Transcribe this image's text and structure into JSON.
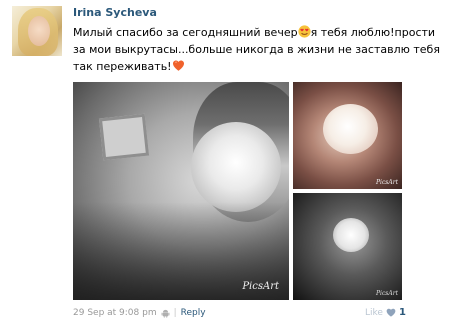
{
  "post": {
    "author": "Irina Sycheva",
    "text_line1_a": "Милый спасибо за сегодняшний вечер",
    "text_line1_b": "я тебя люблю!прости",
    "text_line2": "за мои выкрутасы...больше никогда в жизни не заставлю тебя",
    "text_line3": "так переживать!",
    "emoji_1": "smiling-face-with-heart-eyes",
    "emoji_2": "orange-heart",
    "photos": [
      {
        "watermark": "PicsArt"
      },
      {
        "watermark": "PicsArt"
      },
      {
        "watermark": "PicsArt"
      }
    ],
    "footer": {
      "date": "29 Sep at 9:08 pm",
      "separator": "|",
      "reply": "Reply"
    },
    "like": {
      "label": "Like",
      "count": "1"
    }
  },
  "colors": {
    "link": "#2b587a",
    "muted": "#999999",
    "heart": "#f0622c"
  }
}
